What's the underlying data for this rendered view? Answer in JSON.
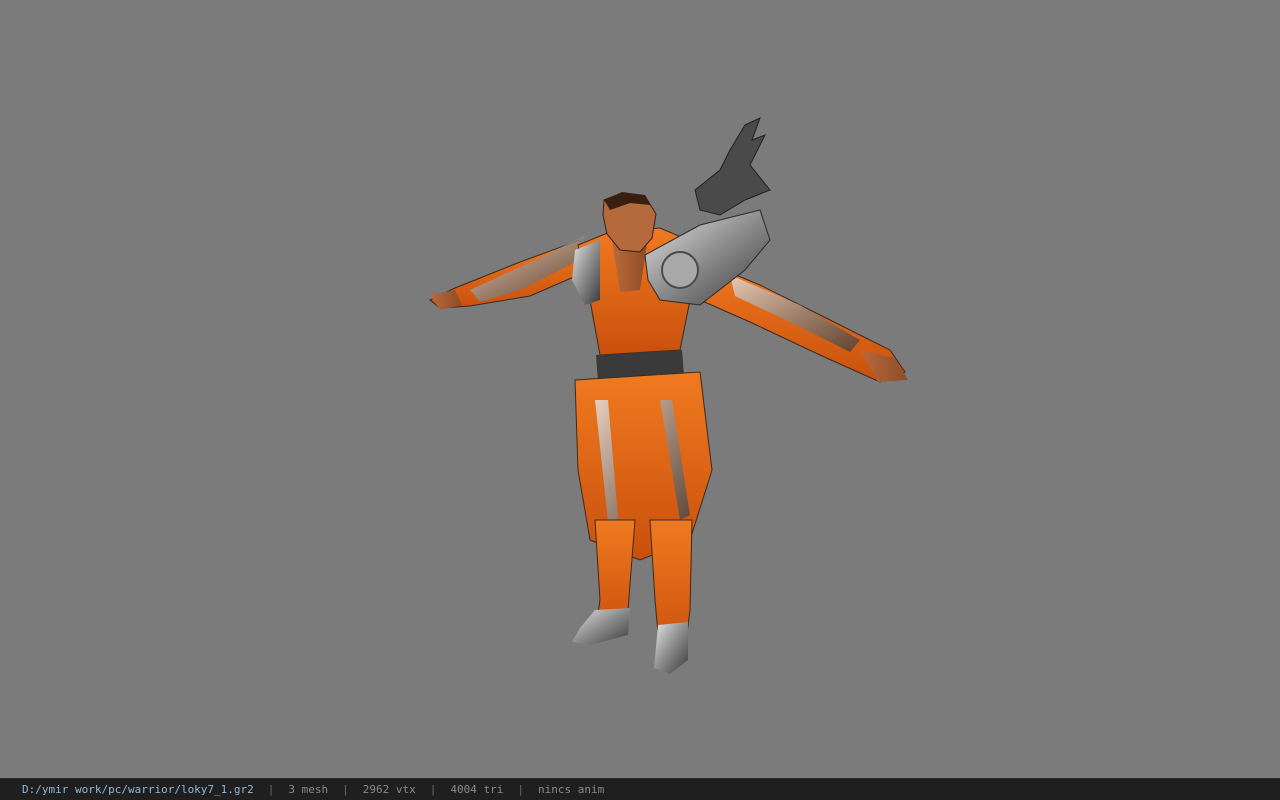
{
  "viewer": {
    "background_color": "#7b7b7b",
    "model_icon": "warrior-3d-model"
  },
  "status_bar": {
    "file_path": "D:/ymir work/pc/warrior/loky7_1.gr2",
    "separator": "|",
    "mesh": "3 mesh",
    "vertices": "2962 vtx",
    "triangles": "4004 tri",
    "animation": "nincs anim",
    "path_color": "#8fb8d8",
    "text_color": "#8a8a8a"
  }
}
